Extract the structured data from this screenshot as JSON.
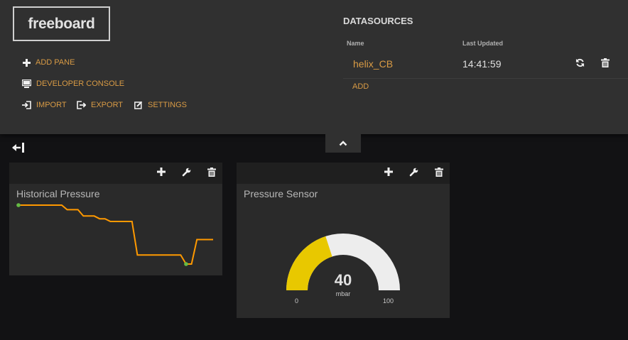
{
  "app": {
    "logo": "freeboard"
  },
  "menu": {
    "add_pane": "ADD PANE",
    "developer_console": "DEVELOPER CONSOLE",
    "import": "IMPORT",
    "export": "EXPORT",
    "settings": "SETTINGS"
  },
  "datasources": {
    "title": "DATASOURCES",
    "col_name": "Name",
    "col_updated": "Last Updated",
    "rows": [
      {
        "name": "helix_CB",
        "last_updated": "14:41:59"
      }
    ],
    "add_label": "ADD"
  },
  "panes": [
    {
      "title": "Historical Pressure",
      "sparkline": [
        100,
        100,
        100,
        100,
        100,
        100,
        100,
        100,
        100,
        95,
        95,
        95,
        88,
        88,
        88,
        85,
        85,
        82,
        82,
        82,
        82,
        82,
        45,
        45,
        45,
        45,
        45,
        45,
        45,
        45,
        45,
        35,
        35,
        62,
        62,
        62,
        62
      ]
    },
    {
      "title": "Pressure Sensor",
      "gauge": {
        "value": 40,
        "units": "mbar",
        "min": 0,
        "max": 100,
        "min_label": "0",
        "max_label": "100"
      }
    }
  ],
  "colors": {
    "accent": "#d99b45",
    "sparkline": "#ff9900",
    "sparkline_marker": "#66bb44",
    "gauge_fill": "#e8c800",
    "gauge_empty": "#ededed"
  }
}
